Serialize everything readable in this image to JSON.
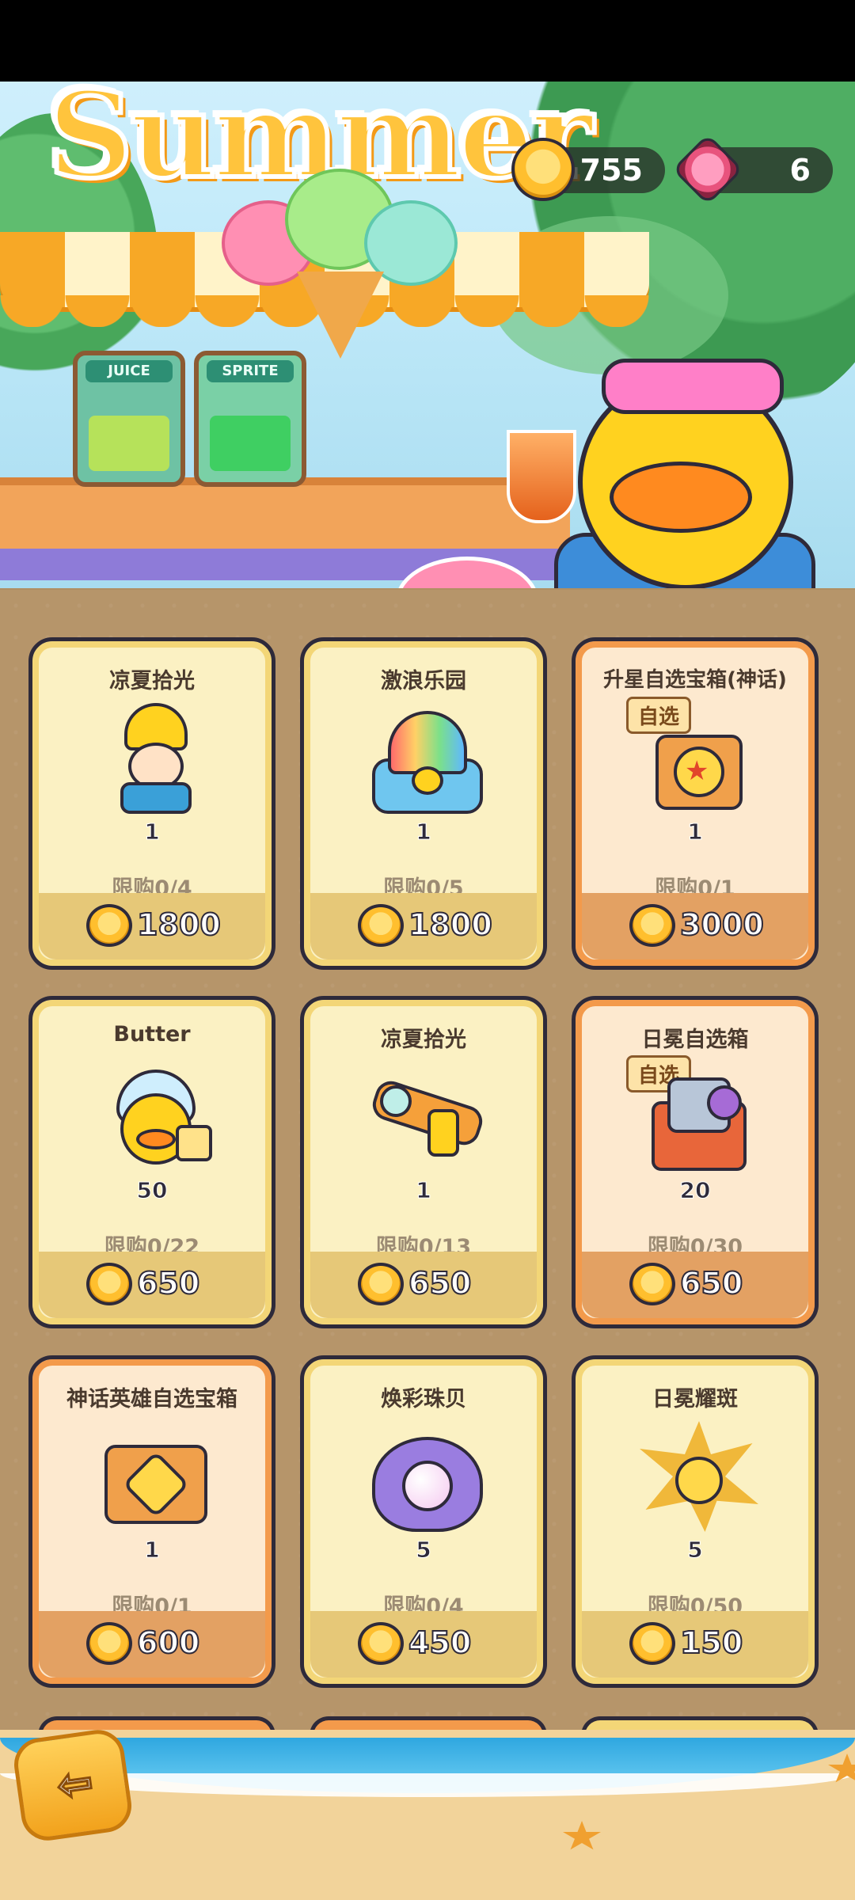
{
  "banner": {
    "title": "Summer",
    "machine_left": "JUICE",
    "machine_right": "SPRITE"
  },
  "currency": {
    "coins": "755",
    "gems": "6"
  },
  "items": [
    {
      "name": "凉夏拾光",
      "qty": "1",
      "limit": "限购0/4",
      "price": "1800",
      "style": "gold",
      "pick": ""
    },
    {
      "name": "激浪乐园",
      "qty": "1",
      "limit": "限购0/5",
      "price": "1800",
      "style": "gold",
      "pick": ""
    },
    {
      "name": "升星自选宝箱(神话)",
      "qty": "1",
      "limit": "限购0/1",
      "price": "3000",
      "style": "orange",
      "pick": "自选"
    },
    {
      "name": "Butter",
      "qty": "50",
      "limit": "限购0/22",
      "price": "650",
      "style": "gold",
      "pick": ""
    },
    {
      "name": "凉夏拾光",
      "qty": "1",
      "limit": "限购0/13",
      "price": "650",
      "style": "gold",
      "pick": ""
    },
    {
      "name": "日冕自选箱",
      "qty": "20",
      "limit": "限购0/30",
      "price": "650",
      "style": "orange",
      "pick": "自选"
    },
    {
      "name": "神话英雄自选宝箱",
      "qty": "1",
      "limit": "限购0/1",
      "price": "600",
      "style": "orange",
      "pick": ""
    },
    {
      "name": "焕彩珠贝",
      "qty": "5",
      "limit": "限购0/4",
      "price": "450",
      "style": "gold",
      "pick": ""
    },
    {
      "name": "日冕耀斑",
      "qty": "5",
      "limit": "限购0/50",
      "price": "150",
      "style": "gold",
      "pick": ""
    }
  ],
  "icons": {
    "coin": "duck-coin-icon",
    "gem": "heart-gem-icon",
    "back": "back-arrow-icon"
  }
}
